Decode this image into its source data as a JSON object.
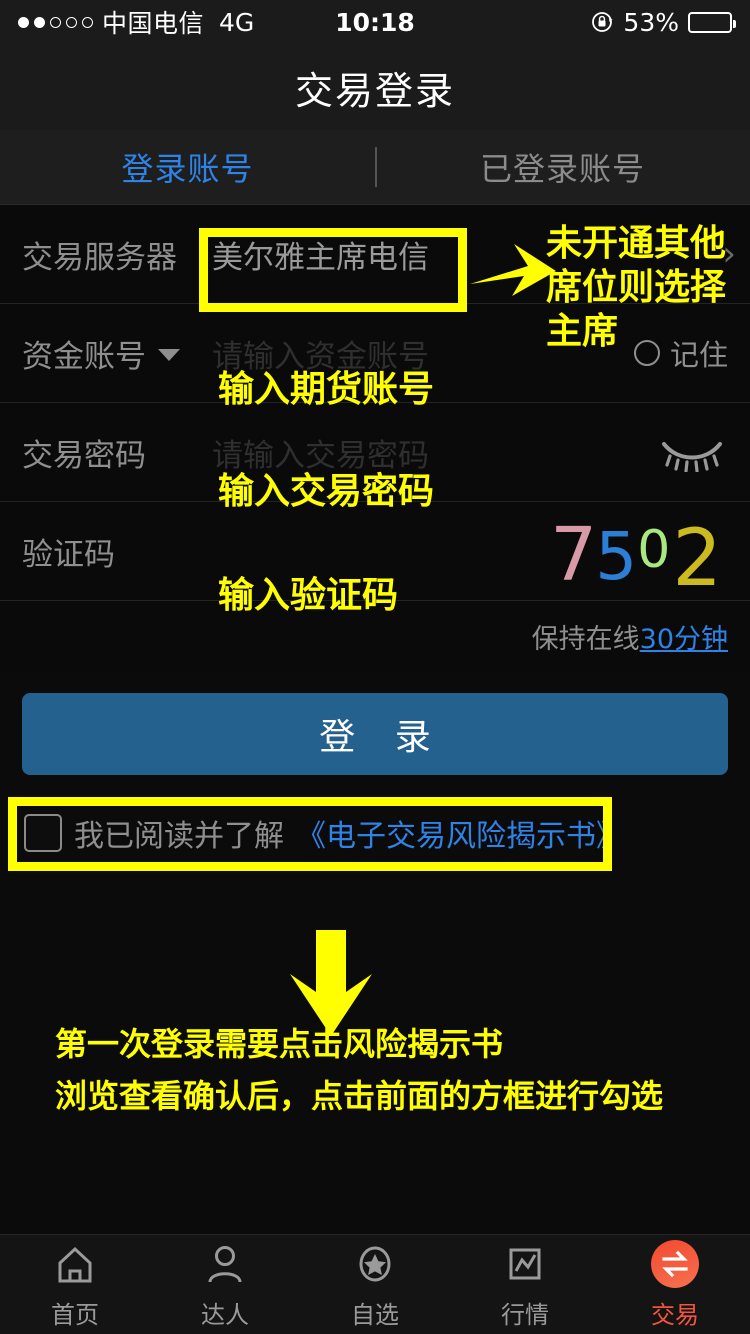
{
  "status_bar": {
    "carrier": "中国电信",
    "network": "4G",
    "time": "10:18",
    "battery_percent": "53%",
    "battery_level": 53,
    "signal_dots_filled": 2,
    "signal_dots_total": 5,
    "rotation_lock_icon": "rotation-lock-icon"
  },
  "navbar": {
    "title": "交易登录"
  },
  "tabs": [
    {
      "label": "登录账号",
      "active": true
    },
    {
      "label": "已登录账号",
      "active": false
    }
  ],
  "form": {
    "server_row": {
      "label": "交易服务器",
      "value": "美尔雅主席电信",
      "chevron": "›"
    },
    "account_row": {
      "label": "资金账号",
      "placeholder": "请输入资金账号",
      "remember_label": "记住",
      "remember_checked": false
    },
    "password_row": {
      "label": "交易密码",
      "placeholder": "请输入交易密码",
      "eye_icon": "eye-closed-icon"
    },
    "captcha_row": {
      "label": "验证码",
      "digits": [
        {
          "char": "7",
          "color": "#d79aa6"
        },
        {
          "char": "5",
          "color": "#2b7fd4"
        },
        {
          "char": "0",
          "color": "#a9e87e"
        },
        {
          "char": "2",
          "color": "#ccbb1e"
        }
      ]
    },
    "keep_online": {
      "text": "保持在线",
      "link": "30分钟"
    }
  },
  "login_button": {
    "label": "登 录"
  },
  "agreement": {
    "checked": false,
    "text": "我已阅读并了解",
    "link": "《电子交易风险揭示书》"
  },
  "annotations": {
    "server_note": "未开通其他席位则选择主席",
    "account_note": "输入期货账号",
    "password_note": "输入交易密码",
    "captcha_note": "输入验证码",
    "bottom_line1": "第一次登录需要点击风险揭示书",
    "bottom_line2": "浏览查看确认后，点击前面的方框进行勾选",
    "highlight_color": "#ffff00"
  },
  "tabbar": [
    {
      "label": "首页",
      "icon": "home-icon",
      "active": false
    },
    {
      "label": "达人",
      "icon": "person-icon",
      "active": false
    },
    {
      "label": "自选",
      "icon": "star-circle-icon",
      "active": false
    },
    {
      "label": "行情",
      "icon": "chart-square-icon",
      "active": false
    },
    {
      "label": "交易",
      "icon": "exchange-icon",
      "active": true
    }
  ],
  "colors": {
    "accent_blue": "#2f82e6",
    "button_blue": "#24618f",
    "active_red": "#f2553d",
    "highlight_yellow": "#ffff00",
    "background": "#0a0a0a"
  }
}
